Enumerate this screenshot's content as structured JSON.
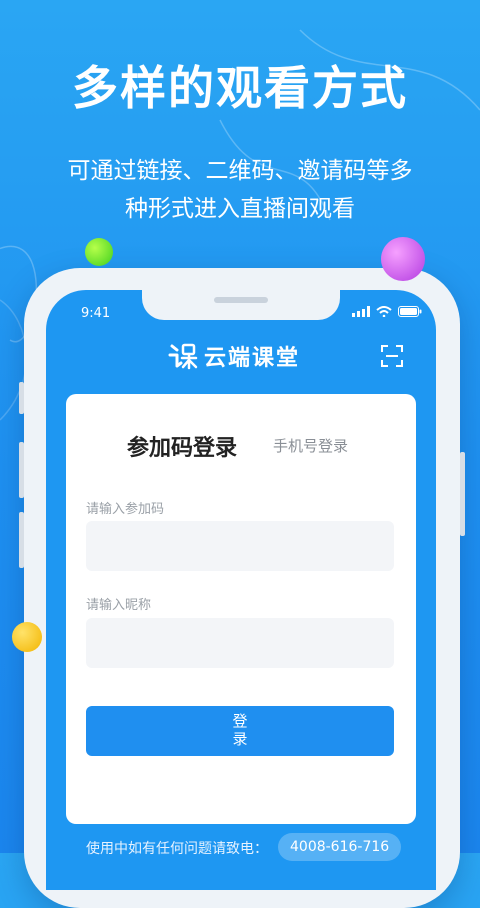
{
  "headline": "多样的观看方式",
  "subtitle_line1": "可通过链接、二维码、邀请码等多",
  "subtitle_line2": "种形式进入直播间观看",
  "status_bar": {
    "time": "9:41"
  },
  "app": {
    "brand": "云端课堂"
  },
  "login": {
    "tab_active": "参加码登录",
    "tab_other": "手机号登录",
    "code_label": "请输入参加码",
    "code_value": "",
    "nickname_label": "请输入昵称",
    "nickname_value": "",
    "button_label": "登录"
  },
  "footer": {
    "help_text": "使用中如有任何问题请致电：",
    "phone": "4008-616-716"
  },
  "colors": {
    "bg": "#1e90f0",
    "accent": "#1f8ff0"
  }
}
